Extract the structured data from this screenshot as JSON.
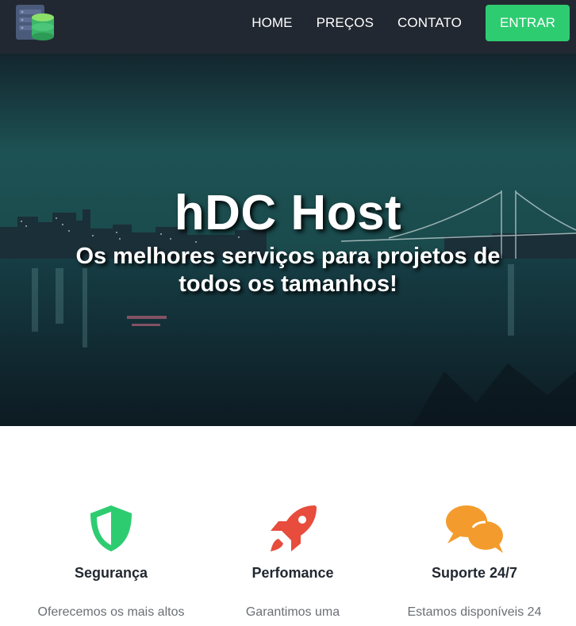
{
  "nav": {
    "links": [
      "HOME",
      "PREÇOS",
      "CONTATO"
    ],
    "enter_label": "ENTRAR"
  },
  "hero": {
    "title": "hDC Host",
    "subtitle": "Os melhores serviços para projetos de todos os tamanhos!"
  },
  "features": [
    {
      "icon": "shield-icon",
      "color": "#2ecc71",
      "title": "Segurança",
      "text": "Oferecemos os mais altos"
    },
    {
      "icon": "rocket-icon",
      "color": "#e74c3c",
      "title": "Perfomance",
      "text": "Garantimos uma"
    },
    {
      "icon": "comments-icon",
      "color": "#f39c2d",
      "title": "Suporte 24/7",
      "text": "Estamos disponíveis 24"
    }
  ],
  "colors": {
    "navbar": "#222831",
    "accent": "#2ecc71"
  }
}
